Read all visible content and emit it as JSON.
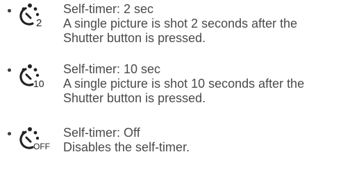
{
  "items": [
    {
      "icon": "self-timer-2-icon",
      "icon_label": "2",
      "title": "Self-timer: 2 sec",
      "desc_line1": "A single picture is shot 2 seconds after the",
      "desc_line2": "Shutter button is pressed."
    },
    {
      "icon": "self-timer-10-icon",
      "icon_label": "10",
      "title": "Self-timer: 10 sec",
      "desc_line1": "A single picture is shot 10 seconds after the",
      "desc_line2": "Shutter button is pressed."
    },
    {
      "icon": "self-timer-off-icon",
      "icon_label": "OFF",
      "title": "Self-timer: Off",
      "desc_line1": "Disables the self-timer."
    }
  ]
}
